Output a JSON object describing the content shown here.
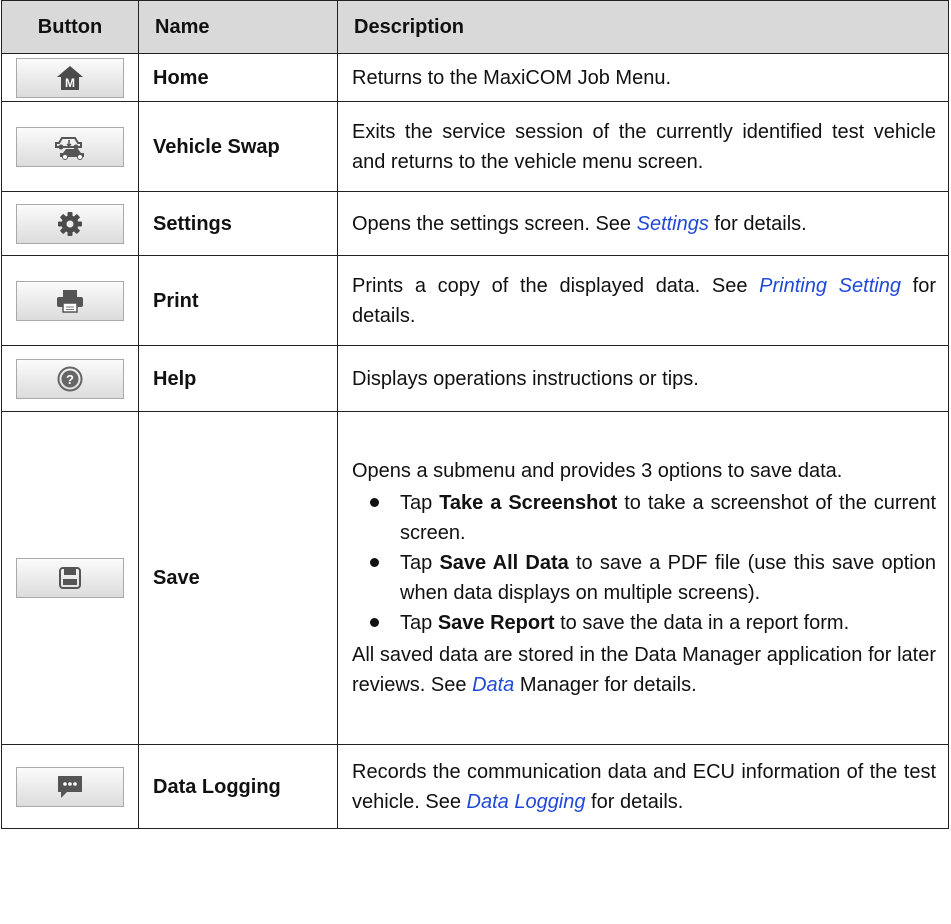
{
  "header": {
    "col_button": "Button",
    "col_name": "Name",
    "col_description": "Description"
  },
  "rows": {
    "home": {
      "icon": "home-icon",
      "name": "Home",
      "desc": "Returns to the MaxiCOM Job Menu."
    },
    "vehicle_swap": {
      "icon": "vehicle-swap-icon",
      "name": "Vehicle Swap",
      "desc": "Exits the service session of the currently identified test vehicle and returns to the vehicle menu screen."
    },
    "settings": {
      "icon": "gear-icon",
      "name": "Settings",
      "desc_pre": "Opens the settings screen. See ",
      "link": "Settings",
      "desc_post": " for details."
    },
    "print": {
      "icon": "printer-icon",
      "name": "Print",
      "desc_pre": "Prints a copy of the displayed data. See ",
      "link": "Printing Setting",
      "desc_post": " for details."
    },
    "help": {
      "icon": "help-icon",
      "name": "Help",
      "desc": "Displays operations instructions or tips."
    },
    "save": {
      "icon": "save-icon",
      "name": "Save",
      "intro": "Opens a submenu and provides 3 options to save data.",
      "bullets": [
        {
          "pre": "Tap ",
          "bold": "Take a Screenshot",
          "post": " to take a screenshot of the current screen."
        },
        {
          "pre": "Tap ",
          "bold": "Save All Data",
          "post": " to save a PDF file (use this save option when data displays on multiple screens)."
        },
        {
          "pre": "Tap ",
          "bold": "Save Report",
          "post": " to save the data in a report form."
        }
      ],
      "outro_pre": "All saved data are stored in the Data Manager application for later reviews. See ",
      "link": "Data",
      "outro_post": " Manager for details."
    },
    "data_logging": {
      "icon": "chat-icon",
      "name": "Data Logging",
      "desc_pre": "Records the communication data and ECU information of the test vehicle. See ",
      "link": "Data Logging",
      "desc_post": " for details."
    }
  }
}
